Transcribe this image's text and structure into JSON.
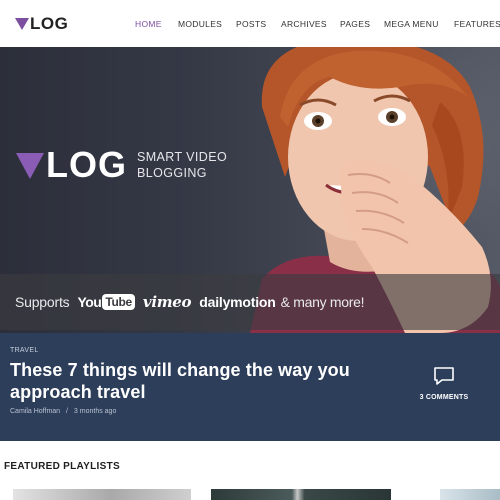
{
  "header": {
    "logo": "LOG",
    "nav": [
      {
        "label": "HOME",
        "active": true
      },
      {
        "label": "MODULES",
        "active": false
      },
      {
        "label": "POSTS",
        "active": false
      },
      {
        "label": "ARCHIVES",
        "active": false
      },
      {
        "label": "PAGES",
        "active": false
      },
      {
        "label": "MEGA MENU",
        "active": false
      },
      {
        "label": "FEATURES",
        "active": false
      }
    ]
  },
  "hero": {
    "brand": "LOG",
    "tagline_line1": "SMART VIDEO",
    "tagline_line2": "BLOGGING",
    "supports_label": "Supports",
    "youtube_you": "You",
    "youtube_tube": "Tube",
    "vimeo": "vimeo",
    "dailymotion": "dailymotion",
    "more": "& many more!"
  },
  "featured_post": {
    "category": "TRAVEL",
    "title": "These 7 things will change the way you approach travel",
    "author": "Camila Hoffman",
    "separator": "/",
    "time": "3 months ago",
    "comments": "3 COMMENTS"
  },
  "playlists": {
    "title": "FEATURED PLAYLISTS"
  },
  "colors": {
    "accent": "#7d4fa0",
    "post_bg": "#2d3e5a"
  }
}
